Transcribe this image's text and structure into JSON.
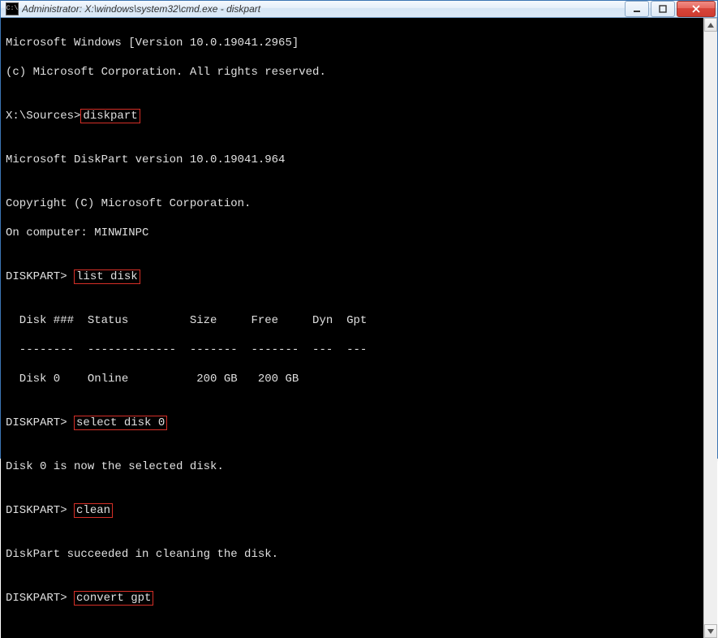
{
  "window": {
    "title": "Administrator: X:\\windows\\system32\\cmd.exe - diskpart",
    "icon_text": "C:\\"
  },
  "controls": {
    "minimize": "minimize",
    "maximize": "maximize",
    "close": "close"
  },
  "terminal": {
    "header1": "Microsoft Windows [Version 10.0.19041.2965]",
    "header2": "(c) Microsoft Corporation. All rights reserved.",
    "prompt1_prefix": "X:\\Sources>",
    "cmd1": "diskpart",
    "dp_version": "Microsoft DiskPart version 10.0.19041.964",
    "dp_copy": "Copyright (C) Microsoft Corporation.",
    "dp_comp": "On computer: MINWINPC",
    "dp_prompt": "DISKPART> ",
    "cmd2": "list disk",
    "table_header": "  Disk ###  Status         Size     Free     Dyn  Gpt",
    "table_sep": "  --------  -------------  -------  -------  ---  ---",
    "table_row0": "  Disk 0    Online          200 GB   200 GB",
    "cmd3": "select disk 0",
    "resp3": "Disk 0 is now the selected disk.",
    "cmd4": "clean",
    "resp4": "DiskPart succeeded in cleaning the disk.",
    "cmd5": "convert gpt"
  }
}
